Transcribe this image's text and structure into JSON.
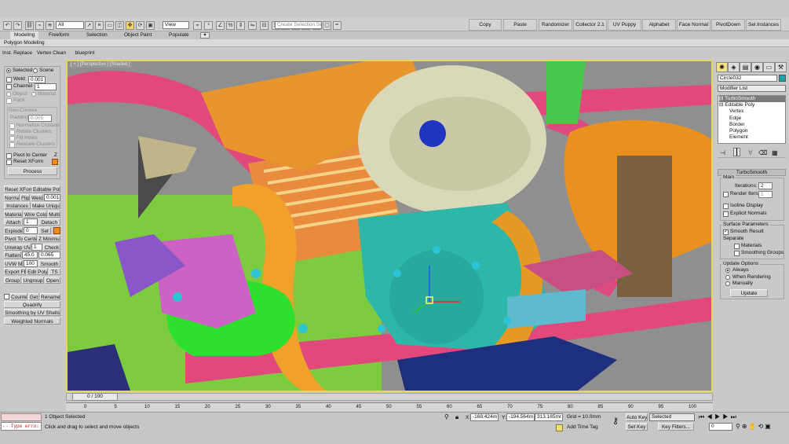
{
  "toolbar": {
    "selection_filter": "All",
    "ref_coord": "View",
    "selection_set_placeholder": "Create Selection Se",
    "icons": [
      "undo-icon",
      "redo-icon",
      "link-icon",
      "unlink-icon",
      "bind-icon",
      "select-icon",
      "select-by-name-icon",
      "region-icon",
      "window-crossing-icon",
      "move-icon",
      "rotate-icon",
      "scale-icon",
      "pivot-icon",
      "snap-icon",
      "angle-snap-icon",
      "percent-snap-icon",
      "spinner-snap-icon",
      "mirror-icon",
      "align-icon",
      "layer-icon",
      "curve-editor-icon",
      "schematic-icon",
      "material-editor-icon",
      "render-setup-icon",
      "render-frame-icon",
      "render-icon"
    ],
    "quick_buttons": [
      "Copy",
      "Paste",
      "Randomizer",
      "Collector 2.1",
      "UV Puppy",
      "Alphabet",
      "Face Normal",
      "PivotDown",
      "Sel.Instances"
    ]
  },
  "ribbon": {
    "tabs": [
      "Modeling",
      "Freeform",
      "Selection",
      "Object Paint",
      "Populate"
    ],
    "active_tab": "Modeling",
    "sub_tab": "Polygon Modeling"
  },
  "left_panel": {
    "top_buttons": [
      "Inst. Replace",
      "Vertex Clean",
      "blueprint"
    ],
    "pack": {
      "selected_label": "Selected",
      "scene_label": "Scene",
      "weld_label": "Weld",
      "weld_value": "0.001",
      "channel_label": "Channel",
      "channel_value": "1",
      "object_label": "Object",
      "material_label": "Material",
      "pack_label": "Pack",
      "nonconvex_label": "Non-Convex",
      "padding_label": "Padding",
      "padding_value": "0.005",
      "normalize_label": "Normalize Clusters",
      "rotate_label": "Rotate Clusters",
      "fillholes_label": "Fill Holes",
      "rescale_label": "Rescale Clusters",
      "pivot_center": "Pivot to Center",
      "pivot_center_key": "Z",
      "reset_xform": "Reset XForm",
      "process": "Process"
    },
    "grid_rows": [
      [
        "Reset XForm",
        "Editable Poly"
      ],
      [
        "Normal",
        "Flip",
        "Weld",
        "0.001"
      ],
      [
        "Instances",
        "Make Unique"
      ],
      [
        "Material",
        "Wire Color",
        "Multi"
      ],
      [
        "Attach",
        "1",
        "Detach"
      ],
      [
        "Explode",
        "0",
        "Set"
      ],
      [
        "Pivot To Center",
        "Z Minimum"
      ],
      [
        "Unwrap UVW",
        "1",
        "Check"
      ],
      [
        "Flatten",
        "45.0",
        "0.065"
      ],
      [
        "UVW Map",
        "100",
        "Smooth"
      ],
      [
        "Export FBX",
        "Edit Poly",
        "TS"
      ],
      [
        "Group",
        "Ungroup",
        "Open"
      ]
    ],
    "counter_row": [
      "Counter",
      "Get",
      "Rename"
    ],
    "quadrify": "Quadrify",
    "smoothing_uv": "Smoothing by UV Shells",
    "weighted_normals": "Weighted Normals"
  },
  "viewport": {
    "label": "[ + ] [Perspective ] [Shaded ]",
    "border_color": "#e7d65a"
  },
  "right_panel": {
    "object_name": "Circle032",
    "object_color": "#1d9fa6",
    "modifier_list": "Modifier List",
    "stack": [
      {
        "label": "TurboSmooth",
        "level": 0,
        "selected": true
      },
      {
        "label": "Editable Poly",
        "level": 0,
        "selected": false
      },
      {
        "label": "Vertex",
        "level": 1,
        "selected": false
      },
      {
        "label": "Edge",
        "level": 1,
        "selected": false
      },
      {
        "label": "Border",
        "level": 1,
        "selected": false
      },
      {
        "label": "Polygon",
        "level": 1,
        "selected": false
      },
      {
        "label": "Element",
        "level": 1,
        "selected": false
      }
    ],
    "turbosmooth": {
      "title": "TurboSmooth",
      "main_label": "Main",
      "iterations_label": "Iterations:",
      "iterations_value": "2",
      "render_iters_label": "Render Iters:",
      "render_iters_value": "1",
      "isoline_label": "Isoline Display",
      "explicit_normals_label": "Explicit Normals",
      "surface_params_label": "Surface Parameters",
      "smooth_result_label": "Smooth Result",
      "separate_label": "Separate",
      "materials_label": "Materials",
      "smoothing_groups_label": "Smoothing Groups",
      "update_options_label": "Update Options",
      "always_label": "Always",
      "when_rendering_label": "When Rendering",
      "manually_label": "Manually",
      "update_button": "Update"
    }
  },
  "timeline": {
    "slider_label": "0 / 100",
    "ticks": [
      "0",
      "5",
      "10",
      "15",
      "20",
      "25",
      "30",
      "35",
      "40",
      "45",
      "50",
      "55",
      "60",
      "65",
      "70",
      "75",
      "80",
      "85",
      "90",
      "95",
      "100"
    ]
  },
  "status": {
    "maxscript": "-- Type erro:",
    "selected_count": "1 Object Selected",
    "prompt": "Click and drag to select and move objects",
    "x_label": "X:",
    "x_value": "-168.424m",
    "y_label": "Y:",
    "y_value": "-194.564m",
    "z_label": "Z:",
    "z_value": "313.185mr",
    "grid": "Grid = 10.0mm",
    "add_time_tag": "Add Time Tag",
    "auto_key": "Auto Key",
    "set_key": "Set Key",
    "key_mode": "Selected",
    "key_filters": "Key Filters...",
    "frame": "0"
  }
}
